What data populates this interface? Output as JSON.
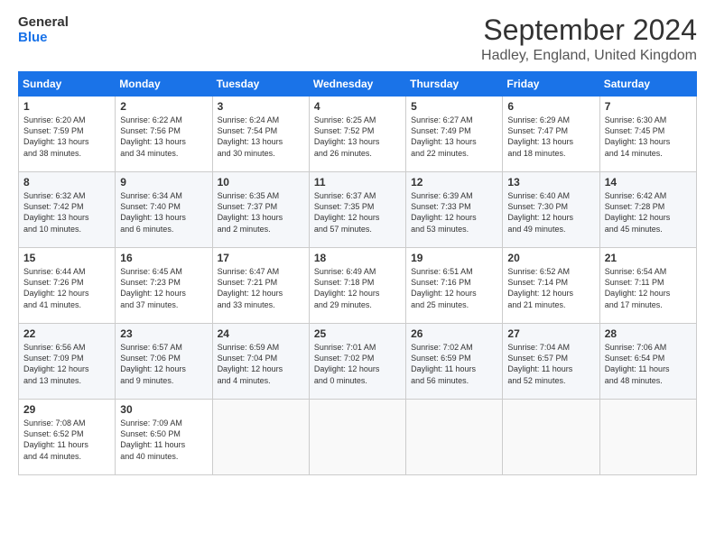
{
  "logo": {
    "line1": "General",
    "line2": "Blue"
  },
  "title": "September 2024",
  "subtitle": "Hadley, England, United Kingdom",
  "days_header": [
    "Sunday",
    "Monday",
    "Tuesday",
    "Wednesday",
    "Thursday",
    "Friday",
    "Saturday"
  ],
  "weeks": [
    [
      {
        "day": "1",
        "info": "Sunrise: 6:20 AM\nSunset: 7:59 PM\nDaylight: 13 hours\nand 38 minutes."
      },
      {
        "day": "2",
        "info": "Sunrise: 6:22 AM\nSunset: 7:56 PM\nDaylight: 13 hours\nand 34 minutes."
      },
      {
        "day": "3",
        "info": "Sunrise: 6:24 AM\nSunset: 7:54 PM\nDaylight: 13 hours\nand 30 minutes."
      },
      {
        "day": "4",
        "info": "Sunrise: 6:25 AM\nSunset: 7:52 PM\nDaylight: 13 hours\nand 26 minutes."
      },
      {
        "day": "5",
        "info": "Sunrise: 6:27 AM\nSunset: 7:49 PM\nDaylight: 13 hours\nand 22 minutes."
      },
      {
        "day": "6",
        "info": "Sunrise: 6:29 AM\nSunset: 7:47 PM\nDaylight: 13 hours\nand 18 minutes."
      },
      {
        "day": "7",
        "info": "Sunrise: 6:30 AM\nSunset: 7:45 PM\nDaylight: 13 hours\nand 14 minutes."
      }
    ],
    [
      {
        "day": "8",
        "info": "Sunrise: 6:32 AM\nSunset: 7:42 PM\nDaylight: 13 hours\nand 10 minutes."
      },
      {
        "day": "9",
        "info": "Sunrise: 6:34 AM\nSunset: 7:40 PM\nDaylight: 13 hours\nand 6 minutes."
      },
      {
        "day": "10",
        "info": "Sunrise: 6:35 AM\nSunset: 7:37 PM\nDaylight: 13 hours\nand 2 minutes."
      },
      {
        "day": "11",
        "info": "Sunrise: 6:37 AM\nSunset: 7:35 PM\nDaylight: 12 hours\nand 57 minutes."
      },
      {
        "day": "12",
        "info": "Sunrise: 6:39 AM\nSunset: 7:33 PM\nDaylight: 12 hours\nand 53 minutes."
      },
      {
        "day": "13",
        "info": "Sunrise: 6:40 AM\nSunset: 7:30 PM\nDaylight: 12 hours\nand 49 minutes."
      },
      {
        "day": "14",
        "info": "Sunrise: 6:42 AM\nSunset: 7:28 PM\nDaylight: 12 hours\nand 45 minutes."
      }
    ],
    [
      {
        "day": "15",
        "info": "Sunrise: 6:44 AM\nSunset: 7:26 PM\nDaylight: 12 hours\nand 41 minutes."
      },
      {
        "day": "16",
        "info": "Sunrise: 6:45 AM\nSunset: 7:23 PM\nDaylight: 12 hours\nand 37 minutes."
      },
      {
        "day": "17",
        "info": "Sunrise: 6:47 AM\nSunset: 7:21 PM\nDaylight: 12 hours\nand 33 minutes."
      },
      {
        "day": "18",
        "info": "Sunrise: 6:49 AM\nSunset: 7:18 PM\nDaylight: 12 hours\nand 29 minutes."
      },
      {
        "day": "19",
        "info": "Sunrise: 6:51 AM\nSunset: 7:16 PM\nDaylight: 12 hours\nand 25 minutes."
      },
      {
        "day": "20",
        "info": "Sunrise: 6:52 AM\nSunset: 7:14 PM\nDaylight: 12 hours\nand 21 minutes."
      },
      {
        "day": "21",
        "info": "Sunrise: 6:54 AM\nSunset: 7:11 PM\nDaylight: 12 hours\nand 17 minutes."
      }
    ],
    [
      {
        "day": "22",
        "info": "Sunrise: 6:56 AM\nSunset: 7:09 PM\nDaylight: 12 hours\nand 13 minutes."
      },
      {
        "day": "23",
        "info": "Sunrise: 6:57 AM\nSunset: 7:06 PM\nDaylight: 12 hours\nand 9 minutes."
      },
      {
        "day": "24",
        "info": "Sunrise: 6:59 AM\nSunset: 7:04 PM\nDaylight: 12 hours\nand 4 minutes."
      },
      {
        "day": "25",
        "info": "Sunrise: 7:01 AM\nSunset: 7:02 PM\nDaylight: 12 hours\nand 0 minutes."
      },
      {
        "day": "26",
        "info": "Sunrise: 7:02 AM\nSunset: 6:59 PM\nDaylight: 11 hours\nand 56 minutes."
      },
      {
        "day": "27",
        "info": "Sunrise: 7:04 AM\nSunset: 6:57 PM\nDaylight: 11 hours\nand 52 minutes."
      },
      {
        "day": "28",
        "info": "Sunrise: 7:06 AM\nSunset: 6:54 PM\nDaylight: 11 hours\nand 48 minutes."
      }
    ],
    [
      {
        "day": "29",
        "info": "Sunrise: 7:08 AM\nSunset: 6:52 PM\nDaylight: 11 hours\nand 44 minutes."
      },
      {
        "day": "30",
        "info": "Sunrise: 7:09 AM\nSunset: 6:50 PM\nDaylight: 11 hours\nand 40 minutes."
      },
      {
        "day": "",
        "info": ""
      },
      {
        "day": "",
        "info": ""
      },
      {
        "day": "",
        "info": ""
      },
      {
        "day": "",
        "info": ""
      },
      {
        "day": "",
        "info": ""
      }
    ]
  ]
}
